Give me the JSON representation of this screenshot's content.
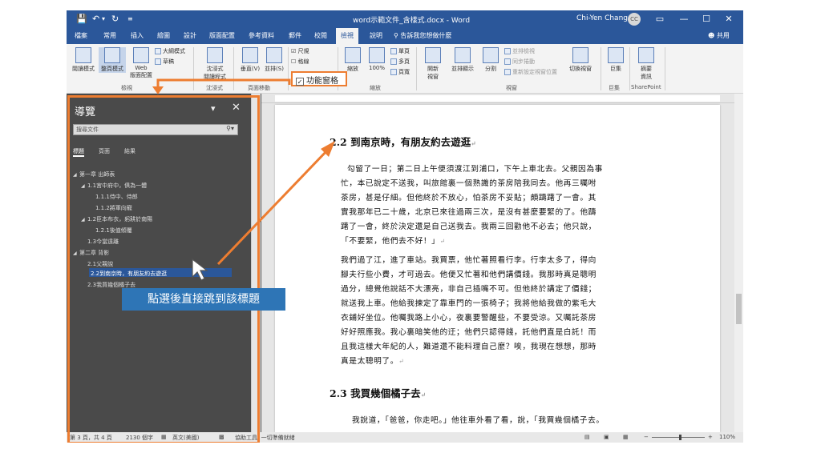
{
  "titlebar": {
    "doc_title": "word示範文件_含樣式.docx - Word",
    "user": "Chi-Yen Chang",
    "avatar": "CC",
    "quick_access": [
      "save-icon",
      "undo-icon",
      "redo-icon",
      "customize-icon"
    ],
    "controls": {
      "options": "▭",
      "minimize": "—",
      "maximize": "☐",
      "close": "✕"
    }
  },
  "tabs": [
    "檔案",
    "常用",
    "插入",
    "繪圖",
    "設計",
    "版面配置",
    "參考資料",
    "郵件",
    "校閱",
    "檢視",
    "說明"
  ],
  "active_tab": "檢視",
  "tell_me": "告訴我您想做什麼",
  "share": "共用",
  "ribbon": {
    "read_mode": "閱讀模式",
    "print_layout": "整頁模式",
    "web_layout": "Web\n版面配置",
    "outline": "大綱模式",
    "draft": "草稿",
    "group_views": "檢視",
    "immersive": "沈浸式\n閱讀程式",
    "group_immersive": "沈浸式",
    "vertical": "垂直(V)",
    "side_by_side": "並排(S)",
    "group_page_move": "頁面移動",
    "ruler": "尺規",
    "gridlines": "格線",
    "nav_pane": "功能窗格",
    "zoom": "縮放",
    "zoom_100": "100%",
    "one_page": "單頁",
    "multi_page": "多頁",
    "page_width": "頁寬",
    "group_zoom": "縮放",
    "new_window": "開新\n視窗",
    "arrange_all": "並排顯示",
    "split": "分割",
    "view_side": "並排檢視",
    "sync_scroll": "同步捲動",
    "reset_pos": "重新設定視窗位置",
    "switch_windows": "切換視窗",
    "group_window": "視窗",
    "macros": "巨集",
    "group_macros": "巨集",
    "properties": "摘要\n資訊",
    "group_sharepoint": "SharePoint"
  },
  "nav": {
    "title": "導覽",
    "search_placeholder": "搜尋文件",
    "tabs": [
      "標題",
      "頁面",
      "結果"
    ],
    "tree": [
      {
        "label": "第一章 出師表",
        "level": 0,
        "arrow": "◢"
      },
      {
        "label": "1.1宮中府中，俱為一體",
        "level": 1,
        "arrow": "◢"
      },
      {
        "label": "1.1.1侍中、侍郎",
        "level": 2,
        "arrow": ""
      },
      {
        "label": "1.1.2將軍向寵",
        "level": 2,
        "arrow": ""
      },
      {
        "label": "1.2臣本布衣，躬耕於南陽",
        "level": 1,
        "arrow": "◢"
      },
      {
        "label": "1.2.1後值傾覆",
        "level": 2,
        "arrow": ""
      },
      {
        "label": "1.3今當遠離",
        "level": 1,
        "arrow": ""
      },
      {
        "label": "第二章 背影",
        "level": 0,
        "arrow": "◢"
      },
      {
        "label": "2.1父親說",
        "level": 1,
        "arrow": ""
      },
      {
        "label": "2.2到南京時，有朋友約去遊逛",
        "level": 1,
        "arrow": ""
      },
      {
        "label": "2.3我買幾個橘子去",
        "level": 1,
        "arrow": ""
      }
    ],
    "selected_index": 9
  },
  "doc": {
    "h1": "2.2 到南京時，有朋友約去遊逛",
    "p1": [
      "勾留了一日；第二日上午便須渡江到浦口，下午上車北去。父親因為事",
      "忙，本已說定不送我，叫旅館裏一個熟識的茶房陪我同去。他再三囑咐",
      "茶房，甚是仔細。但他終於不放心，怕茶房不妥貼；頗躊躇了一會。其",
      "實我那年已二十歲，北京已來往過兩三次，是沒有甚麼要緊的了。他躊",
      "躇了一會，終於決定還是自己送我去。我兩三回勸他不必去；他只說，",
      "「不要緊，他們去不好！」"
    ],
    "p2": [
      "我們過了江，進了車站。我買票，他忙著照看行李。行李太多了，得向",
      "腳夫行些小費，才可過去。他便又忙著和他們講價錢。我那時真是聰明",
      "過分，總覺他說話不大漂亮，非自己插嘴不可。但他終於講定了價錢；",
      "就送我上車。他給我揀定了靠車門的一張椅子；我將他給我做的紫毛大",
      "衣鋪好坐位。他囑我路上小心，夜裏要警醒些，不要受涼。又囑託茶房",
      "好好照應我。我心裏暗笑他的迂；他們只認得錢，託他們直是白託！而",
      "且我這樣大年紀的人，難道還不能料理自己麼？唉，我現在想想，那時",
      "真是太聰明了。"
    ],
    "h2": "2.3 我買幾個橘子去",
    "p3": [
      "我說道，「爸爸，你走吧。」他往車外看了看，說，「我買幾個橘子去。"
    ],
    "return_mark": "↵"
  },
  "status": {
    "page": "第 3 頁，共 4 頁",
    "words": "2130 個字",
    "language": "英文(美國)",
    "accessibility": "協助工具: 一切準備就緒",
    "zoom": "110%"
  },
  "callout": "點選後直接跳到該標題",
  "colors": {
    "word_blue": "#2b579a",
    "annotation_orange": "#ed7d31",
    "callout_blue": "#2e75b6",
    "nav_bg": "#4a4a4a"
  }
}
